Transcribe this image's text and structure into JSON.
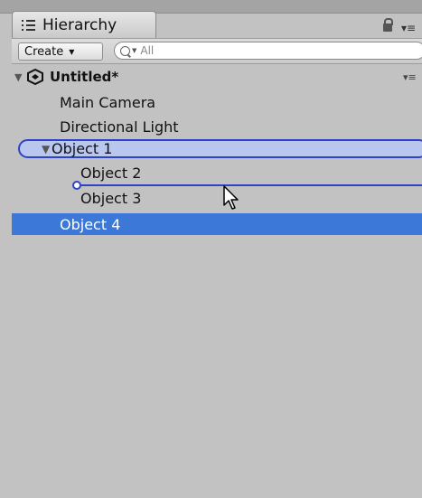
{
  "window": {
    "tab_title": "Hierarchy",
    "tab_icon": "list-icon",
    "lock_icon": "lock-icon",
    "menu_icon": "tab-menu-icon"
  },
  "toolbar": {
    "create_label": "Create",
    "search_placeholder": "All"
  },
  "scene": {
    "name": "Untitled*"
  },
  "items": [
    {
      "label": "Main Camera"
    },
    {
      "label": "Directional Light"
    },
    {
      "label": "Object 1",
      "expanded": true,
      "drop_target": true
    },
    {
      "label": "Object 2"
    },
    {
      "label": "Object 3"
    },
    {
      "label": "Object 4",
      "selected": true
    }
  ],
  "colors": {
    "selection": "#3b78d8",
    "drop_highlight": "#2e43c4",
    "panel": "#c2c2c2"
  }
}
